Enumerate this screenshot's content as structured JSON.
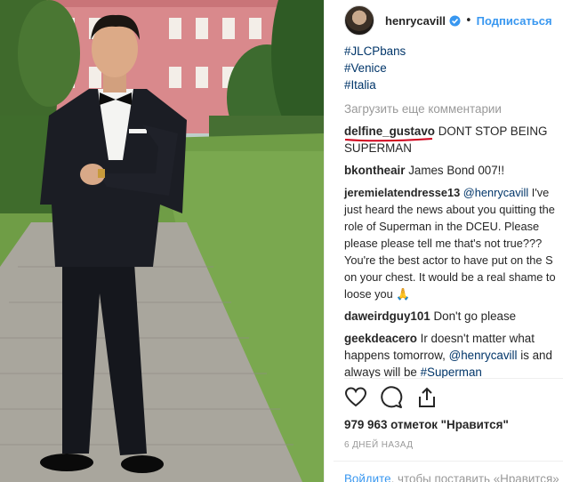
{
  "post": {
    "username": "henrycavill",
    "follow_label": "Подписаться",
    "separator": "•"
  },
  "comments": {
    "hashtags": [
      "#JLCPbans",
      "#Venice",
      "#Italia"
    ],
    "load_more": "Загрузить еще комментарии",
    "items": [
      {
        "user": "delfine_gustavo",
        "text": "DONT STOP BEING SUPERMAN"
      },
      {
        "user": "bkontheair",
        "text": "James Bond 007!!"
      },
      {
        "user": "jeremielatendresse13",
        "mention": "@henrycavill",
        "text": "I've just heard the news about you quitting the role of Superman in the DCEU. Please please please tell me that's not true??? You're the best actor to have put on the S on your chest. It would be a real shame to loose you 🙏"
      },
      {
        "user": "daweirdguy101",
        "text": "Don't go please"
      },
      {
        "user": "geekdeacero",
        "text": "Ir doesn't matter what happens tomorrow,",
        "mention": "@henrycavill",
        "text_after": "is and always will be",
        "hashtag": "#Superman"
      }
    ]
  },
  "stats": {
    "likes": "979 963 отметок \"Нравится\"",
    "date": "6 ДНЕЙ НАЗАД"
  },
  "footer": {
    "login_link": "Войдите",
    "login_text": ", чтобы поставить «Нравится» или"
  },
  "icons": {
    "verified": "verified-badge-icon",
    "like": "heart-icon",
    "comment": "comment-bubble-icon",
    "share": "share-icon"
  },
  "colors": {
    "link_blue": "#3897f0",
    "tag_blue": "#003569",
    "muted": "#999999",
    "underline_red": "#d0021b"
  }
}
